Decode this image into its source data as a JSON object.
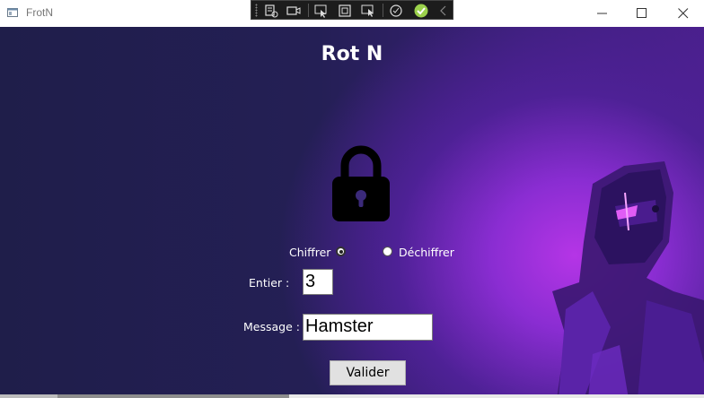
{
  "window": {
    "title": "FrotN"
  },
  "page": {
    "heading": "Rot N"
  },
  "mode": {
    "chiffrer_label": "Chiffrer",
    "dechiffrer_label": "Déchiffrer",
    "selected": "Chiffrer"
  },
  "entier": {
    "label": "Entier :",
    "value": "3"
  },
  "message": {
    "label": "Message :",
    "value": "Hamster"
  },
  "actions": {
    "valider_label": "Valider"
  },
  "icons": {
    "app": "window-icon",
    "lock": "padlock-icon",
    "minimize": "minimize-icon",
    "maximize": "maximize-icon",
    "close": "close-icon"
  },
  "colors": {
    "background_dark": "#231f52",
    "glow": "#b535e6",
    "text": "#ffffff"
  }
}
